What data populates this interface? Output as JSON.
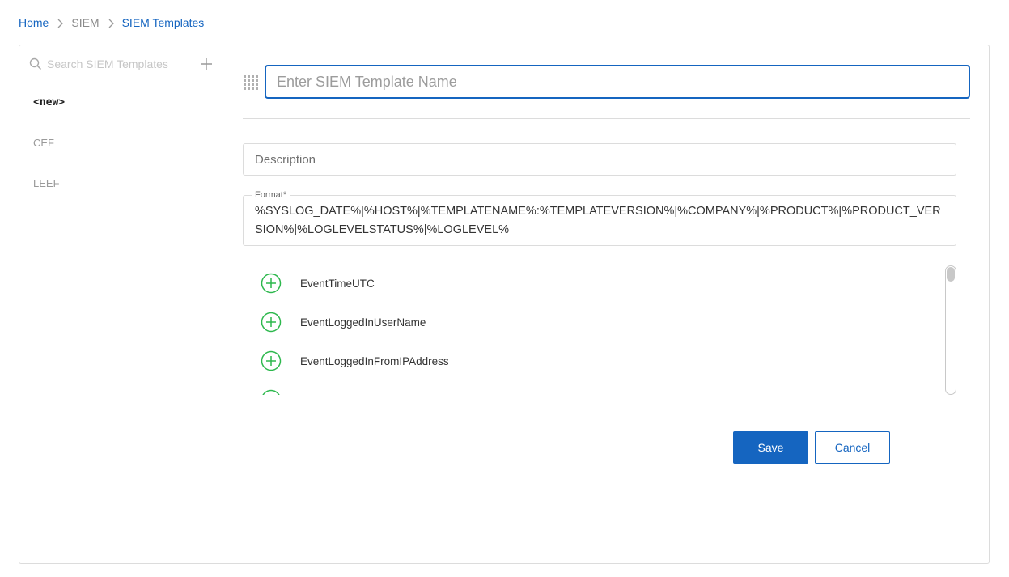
{
  "breadcrumb": {
    "home": "Home",
    "siem": "SIEM",
    "current": "SIEM Templates"
  },
  "sidebar": {
    "search_placeholder": "Search SIEM Templates",
    "items": [
      {
        "label": "<new>"
      },
      {
        "label": "CEF"
      },
      {
        "label": "LEEF"
      }
    ]
  },
  "editor": {
    "name_placeholder": "Enter SIEM Template Name",
    "description_placeholder": "Description",
    "format_label": "Format*",
    "format_value": "%SYSLOG_DATE%|%HOST%|%TEMPLATENAME%:%TEMPLATEVERSION%|%COMPANY%|%PRODUCT%|%PRODUCT_VERSION%|%LOGLEVELSTATUS%|%LOGLEVEL%",
    "fields": [
      {
        "name": "EventTimeUTC"
      },
      {
        "name": "EventLoggedInUserName"
      },
      {
        "name": "EventLoggedInFromIPAddress"
      }
    ]
  },
  "actions": {
    "save_label": "Save",
    "cancel_label": "Cancel"
  },
  "colors": {
    "accent": "#1565c0",
    "add_icon": "#2db84d",
    "border": "#dcdcdc"
  },
  "icons": {
    "breadcrumb_separator": "chevron-right-icon",
    "search": "search-icon",
    "add": "plus-icon",
    "drag": "drag-handle-icon",
    "field_add": "plus-circle-icon"
  }
}
